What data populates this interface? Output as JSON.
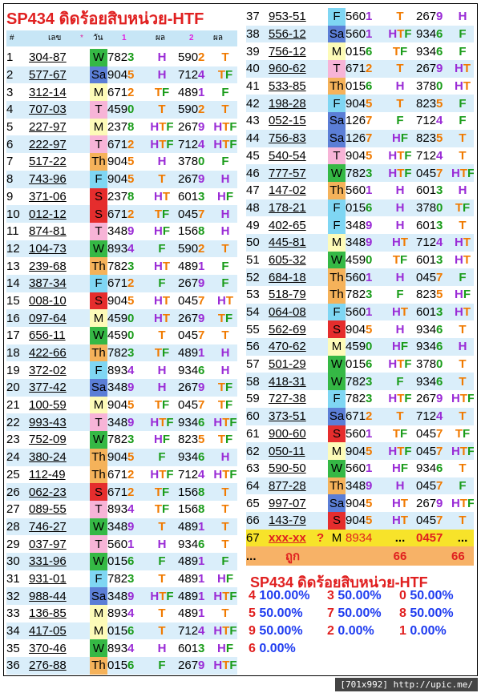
{
  "title": "SP434 ดิดร้อยสิบหน่วย-HTF",
  "header": {
    "no": "#",
    "num": "เลข",
    "star": "*",
    "day": "วัน",
    "one": "1",
    "res1": "ผล",
    "two": "2",
    "res2": "ผล"
  },
  "rows": [
    {
      "no": "1",
      "num": "304-87",
      "day": "W",
      "v1": "7823",
      "r1": "H",
      "v2": "5902",
      "r2": "T"
    },
    {
      "no": "2",
      "num": "577-67",
      "day": "Sa",
      "v1": "9045",
      "r1": "H",
      "v2": "7124",
      "r2": "TF"
    },
    {
      "no": "3",
      "num": "312-14",
      "day": "M",
      "v1": "6712",
      "r1": "TF",
      "v2": "4891",
      "r2": "F"
    },
    {
      "no": "4",
      "num": "707-03",
      "day": "T",
      "v1": "4590",
      "r1": "T",
      "v2": "5902",
      "r2": "T"
    },
    {
      "no": "5",
      "num": "227-97",
      "day": "M",
      "v1": "2378",
      "r1": "HTF",
      "v2": "2679",
      "r2": "HTF"
    },
    {
      "no": "6",
      "num": "222-97",
      "day": "T",
      "v1": "6712",
      "r1": "HTF",
      "v2": "7124",
      "r2": "HTF"
    },
    {
      "no": "7",
      "num": "517-22",
      "day": "Th",
      "v1": "9045",
      "r1": "H",
      "v2": "3780",
      "r2": "F"
    },
    {
      "no": "8",
      "num": "743-96",
      "day": "F",
      "v1": "9045",
      "r1": "T",
      "v2": "2679",
      "r2": "H"
    },
    {
      "no": "9",
      "num": "371-06",
      "day": "S",
      "v1": "2378",
      "r1": "HT",
      "v2": "6013",
      "r2": "HF"
    },
    {
      "no": "10",
      "num": "012-12",
      "day": "S",
      "v1": "6712",
      "r1": "TF",
      "v2": "0457",
      "r2": "H"
    },
    {
      "no": "11",
      "num": "874-81",
      "day": "T",
      "v1": "3489",
      "r1": "HF",
      "v2": "1568",
      "r2": "H"
    },
    {
      "no": "12",
      "num": "104-73",
      "day": "W",
      "v1": "8934",
      "r1": "F",
      "v2": "5902",
      "r2": "T"
    },
    {
      "no": "13",
      "num": "239-68",
      "day": "Th",
      "v1": "7823",
      "r1": "HT",
      "v2": "4891",
      "r2": "F"
    },
    {
      "no": "14",
      "num": "387-34",
      "day": "F",
      "v1": "6712",
      "r1": "F",
      "v2": "2679",
      "r2": "F"
    },
    {
      "no": "15",
      "num": "008-10",
      "day": "S",
      "v1": "9045",
      "r1": "HT",
      "v2": "0457",
      "r2": "HT"
    },
    {
      "no": "16",
      "num": "097-64",
      "day": "M",
      "v1": "4590",
      "r1": "HT",
      "v2": "2679",
      "r2": "TF"
    },
    {
      "no": "17",
      "num": "656-11",
      "day": "W",
      "v1": "4590",
      "r1": "T",
      "v2": "0457",
      "r2": "T"
    },
    {
      "no": "18",
      "num": "422-66",
      "day": "Th",
      "v1": "7823",
      "r1": "TF",
      "v2": "4891",
      "r2": "H"
    },
    {
      "no": "19",
      "num": "372-02",
      "day": "F",
      "v1": "8934",
      "r1": "H",
      "v2": "9346",
      "r2": "H"
    },
    {
      "no": "20",
      "num": "377-42",
      "day": "Sa",
      "v1": "3489",
      "r1": "H",
      "v2": "2679",
      "r2": "TF"
    },
    {
      "no": "21",
      "num": "100-59",
      "day": "M",
      "v1": "9045",
      "r1": "TF",
      "v2": "0457",
      "r2": "TF"
    },
    {
      "no": "22",
      "num": "993-43",
      "day": "T",
      "v1": "3489",
      "r1": "HTF",
      "v2": "9346",
      "r2": "HTF"
    },
    {
      "no": "23",
      "num": "752-09",
      "day": "W",
      "v1": "7823",
      "r1": "HF",
      "v2": "8235",
      "r2": "TF"
    },
    {
      "no": "24",
      "num": "380-24",
      "day": "Th",
      "v1": "9045",
      "r1": "F",
      "v2": "9346",
      "r2": "H"
    },
    {
      "no": "25",
      "num": "112-49",
      "day": "Th",
      "v1": "6712",
      "r1": "HTF",
      "v2": "7124",
      "r2": "HTF"
    },
    {
      "no": "26",
      "num": "062-23",
      "day": "S",
      "v1": "6712",
      "r1": "TF",
      "v2": "1568",
      "r2": "T"
    },
    {
      "no": "27",
      "num": "089-55",
      "day": "T",
      "v1": "8934",
      "r1": "TF",
      "v2": "1568",
      "r2": "T"
    },
    {
      "no": "28",
      "num": "746-27",
      "day": "W",
      "v1": "3489",
      "r1": "T",
      "v2": "4891",
      "r2": "T"
    },
    {
      "no": "29",
      "num": "037-97",
      "day": "T",
      "v1": "5601",
      "r1": "H",
      "v2": "9346",
      "r2": "T"
    },
    {
      "no": "30",
      "num": "331-96",
      "day": "W",
      "v1": "0156",
      "r1": "F",
      "v2": "4891",
      "r2": "F"
    },
    {
      "no": "31",
      "num": "931-01",
      "day": "F",
      "v1": "7823",
      "r1": "T",
      "v2": "4891",
      "r2": "HF"
    },
    {
      "no": "32",
      "num": "988-44",
      "day": "Sa",
      "v1": "3489",
      "r1": "HTF",
      "v2": "4891",
      "r2": "HTF"
    },
    {
      "no": "33",
      "num": "136-85",
      "day": "M",
      "v1": "8934",
      "r1": "T",
      "v2": "4891",
      "r2": "T"
    },
    {
      "no": "34",
      "num": "417-05",
      "day": "M",
      "v1": "0156",
      "r1": "T",
      "v2": "7124",
      "r2": "HTF"
    },
    {
      "no": "35",
      "num": "370-46",
      "day": "W",
      "v1": "8934",
      "r1": "H",
      "v2": "6013",
      "r2": "HF"
    },
    {
      "no": "36",
      "num": "276-88",
      "day": "Th",
      "v1": "0156",
      "r1": "F",
      "v2": "2679",
      "r2": "HTF"
    },
    {
      "no": "37",
      "num": "953-51",
      "day": "F",
      "v1": "5601",
      "r1": "T",
      "v2": "2679",
      "r2": "H"
    },
    {
      "no": "38",
      "num": "556-12",
      "day": "Sa",
      "v1": "5601",
      "r1": "HTF",
      "v2": "9346",
      "r2": "F"
    },
    {
      "no": "39",
      "num": "756-12",
      "day": "M",
      "v1": "0156",
      "r1": "TF",
      "v2": "9346",
      "r2": "F"
    },
    {
      "no": "40",
      "num": "960-62",
      "day": "T",
      "v1": "6712",
      "r1": "T",
      "v2": "2679",
      "r2": "HT"
    },
    {
      "no": "41",
      "num": "533-85",
      "day": "Th",
      "v1": "0156",
      "r1": "H",
      "v2": "3780",
      "r2": "HT"
    },
    {
      "no": "42",
      "num": "198-28",
      "day": "F",
      "v1": "9045",
      "r1": "T",
      "v2": "8235",
      "r2": "F"
    },
    {
      "no": "43",
      "num": "052-15",
      "day": "Sa",
      "v1": "1267",
      "r1": "F",
      "v2": "7124",
      "r2": "F"
    },
    {
      "no": "44",
      "num": "756-83",
      "day": "Sa",
      "v1": "1267",
      "r1": "HF",
      "v2": "8235",
      "r2": "T"
    },
    {
      "no": "45",
      "num": "540-54",
      "day": "T",
      "v1": "9045",
      "r1": "HTF",
      "v2": "7124",
      "r2": "T"
    },
    {
      "no": "46",
      "num": "777-57",
      "day": "W",
      "v1": "7823",
      "r1": "HTF",
      "v2": "0457",
      "r2": "HTF"
    },
    {
      "no": "47",
      "num": "147-02",
      "day": "Th",
      "v1": "5601",
      "r1": "H",
      "v2": "6013",
      "r2": "H"
    },
    {
      "no": "48",
      "num": "178-21",
      "day": "F",
      "v1": "0156",
      "r1": "H",
      "v2": "3780",
      "r2": "TF"
    },
    {
      "no": "49",
      "num": "402-65",
      "day": "F",
      "v1": "3489",
      "r1": "H",
      "v2": "6013",
      "r2": "T"
    },
    {
      "no": "50",
      "num": "445-81",
      "day": "M",
      "v1": "3489",
      "r1": "HT",
      "v2": "7124",
      "r2": "HT"
    },
    {
      "no": "51",
      "num": "605-32",
      "day": "W",
      "v1": "4590",
      "r1": "TF",
      "v2": "6013",
      "r2": "HT"
    },
    {
      "no": "52",
      "num": "684-18",
      "day": "Th",
      "v1": "5601",
      "r1": "H",
      "v2": "0457",
      "r2": "F"
    },
    {
      "no": "53",
      "num": "518-79",
      "day": "Th",
      "v1": "7823",
      "r1": "F",
      "v2": "8235",
      "r2": "HF"
    },
    {
      "no": "54",
      "num": "064-08",
      "day": "F",
      "v1": "5601",
      "r1": "HT",
      "v2": "6013",
      "r2": "HT"
    },
    {
      "no": "55",
      "num": "562-69",
      "day": "S",
      "v1": "9045",
      "r1": "H",
      "v2": "9346",
      "r2": "T"
    },
    {
      "no": "56",
      "num": "470-62",
      "day": "M",
      "v1": "4590",
      "r1": "HF",
      "v2": "9346",
      "r2": "H"
    },
    {
      "no": "57",
      "num": "501-29",
      "day": "W",
      "v1": "0156",
      "r1": "HTF",
      "v2": "3780",
      "r2": "T"
    },
    {
      "no": "58",
      "num": "418-31",
      "day": "W",
      "v1": "7823",
      "r1": "F",
      "v2": "9346",
      "r2": "T"
    },
    {
      "no": "59",
      "num": "727-38",
      "day": "F",
      "v1": "7823",
      "r1": "HTF",
      "v2": "2679",
      "r2": "HTF"
    },
    {
      "no": "60",
      "num": "373-51",
      "day": "Sa",
      "v1": "6712",
      "r1": "T",
      "v2": "7124",
      "r2": "T"
    },
    {
      "no": "61",
      "num": "900-60",
      "day": "S",
      "v1": "5601",
      "r1": "TF",
      "v2": "0457",
      "r2": "TF"
    },
    {
      "no": "62",
      "num": "050-11",
      "day": "M",
      "v1": "9045",
      "r1": "HTF",
      "v2": "0457",
      "r2": "HTF"
    },
    {
      "no": "63",
      "num": "590-50",
      "day": "W",
      "v1": "5601",
      "r1": "HF",
      "v2": "9346",
      "r2": "T"
    },
    {
      "no": "64",
      "num": "877-28",
      "day": "Th",
      "v1": "3489",
      "r1": "H",
      "v2": "0457",
      "r2": "F"
    },
    {
      "no": "65",
      "num": "997-07",
      "day": "Sa",
      "v1": "9045",
      "r1": "HT",
      "v2": "2679",
      "r2": "HTF"
    },
    {
      "no": "66",
      "num": "143-79",
      "day": "S",
      "v1": "9045",
      "r1": "HT",
      "v2": "0457",
      "r2": "T"
    }
  ],
  "row67": {
    "no": "67",
    "num": "xxx-xx",
    "star": "?",
    "day": "M",
    "v1": "8934",
    "r1": "...",
    "v2": "0457",
    "r2": "..."
  },
  "summary": {
    "dots": "...",
    "label": "ถูก",
    "c1": "66",
    "c2": "66"
  },
  "summary_title": "SP434 ดิดร้อยสิบหน่วย-HTF",
  "percentages": [
    {
      "digit": "4",
      "pct": "100.00%"
    },
    {
      "digit": "3",
      "pct": "50.00%"
    },
    {
      "digit": "0",
      "pct": "50.00%"
    },
    {
      "digit": "5",
      "pct": "50.00%"
    },
    {
      "digit": "7",
      "pct": "50.00%"
    },
    {
      "digit": "8",
      "pct": "50.00%"
    },
    {
      "digit": "9",
      "pct": "50.00%"
    },
    {
      "digit": "2",
      "pct": "0.00%"
    },
    {
      "digit": "1",
      "pct": "0.00%"
    },
    {
      "digit": "6",
      "pct": "0.00%"
    }
  ],
  "footer": "[701x992] http://upic.me/",
  "colors": {
    "title": "#e02020",
    "header_bg": "#c7e6f6",
    "row_bg": "#daeefa",
    "summary_bg": "#f7b267",
    "row67_bg": "#f7e32a",
    "pct_digit": "#e01f1f",
    "pct_value": "#1f3cf0"
  }
}
